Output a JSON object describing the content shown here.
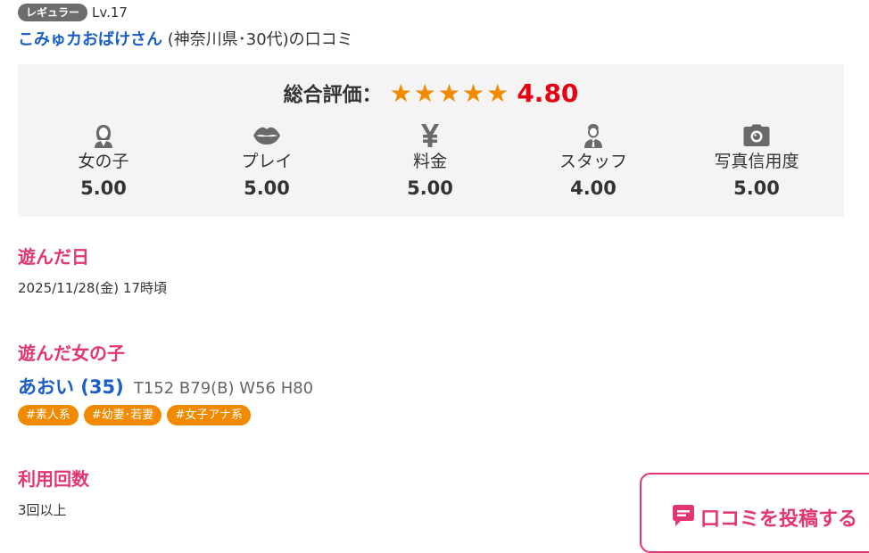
{
  "reviewer": {
    "rank_badge": "レギュラー",
    "level": "Lv.17",
    "name": "こみゅカおばけさん",
    "meta": "(神奈川県･30代)の口コミ"
  },
  "rating": {
    "overall_label": "総合評価：",
    "stars": 5,
    "overall_score": "4.80",
    "categories": [
      {
        "icon": "girl-icon",
        "label": "女の子",
        "score": "5.00"
      },
      {
        "icon": "lips-icon",
        "label": "プレイ",
        "score": "5.00"
      },
      {
        "icon": "yen-icon",
        "label": "料金",
        "score": "5.00"
      },
      {
        "icon": "staff-icon",
        "label": "スタッフ",
        "score": "4.00"
      },
      {
        "icon": "camera-icon",
        "label": "写真信用度",
        "score": "5.00"
      }
    ]
  },
  "visit_date": {
    "title": "遊んだ日",
    "value": "2025/11/28(金) 17時頃"
  },
  "girl": {
    "title": "遊んだ女の子",
    "name": "あおい (35)",
    "spec": "T152 B79(B) W56 H80",
    "tags": [
      "#素人系",
      "#幼妻･若妻",
      "#女子アナ系"
    ]
  },
  "usage": {
    "title": "利用回数",
    "value": "3回以上"
  },
  "post_button": {
    "label": "口コミを投稿する",
    "icon": "comment-icon"
  },
  "colors": {
    "accent_pink": "#e4366e",
    "link_blue": "#1a5fc7",
    "star_orange": "#f28a00",
    "score_red": "#e50012",
    "tag_orange": "#f28a00",
    "badge_gray": "#6d6d6d"
  }
}
